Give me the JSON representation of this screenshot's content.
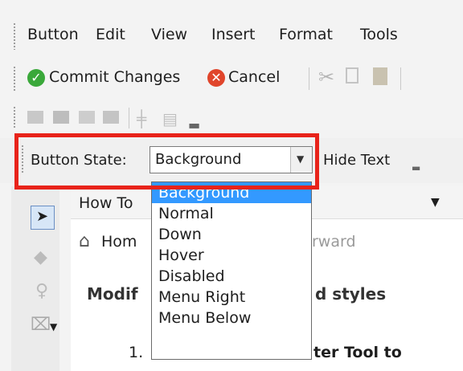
{
  "menubar": {
    "items": [
      "Button",
      "Edit",
      "View",
      "Insert",
      "Format",
      "Tools"
    ]
  },
  "toolbar1": {
    "commit_label": "Commit Changes",
    "cancel_label": "Cancel"
  },
  "button_state": {
    "label": "Button State:",
    "selected": "Background",
    "hide_text_label": "Hide Text",
    "options": [
      "Background",
      "Normal",
      "Down",
      "Hover",
      "Disabled",
      "Menu Right",
      "Menu Below"
    ]
  },
  "panel": {
    "combo_text": "How To",
    "nav_home": "Hom",
    "nav_forward": "rward",
    "heading_left": "Modif",
    "heading_right": "d styles",
    "list_num": "1.",
    "list_text": "ter Tool to"
  },
  "colors": {
    "highlight": "#e8231a",
    "selection": "#3399ff",
    "commit_icon": "#3aa83a",
    "cancel_icon": "#e0452b"
  }
}
